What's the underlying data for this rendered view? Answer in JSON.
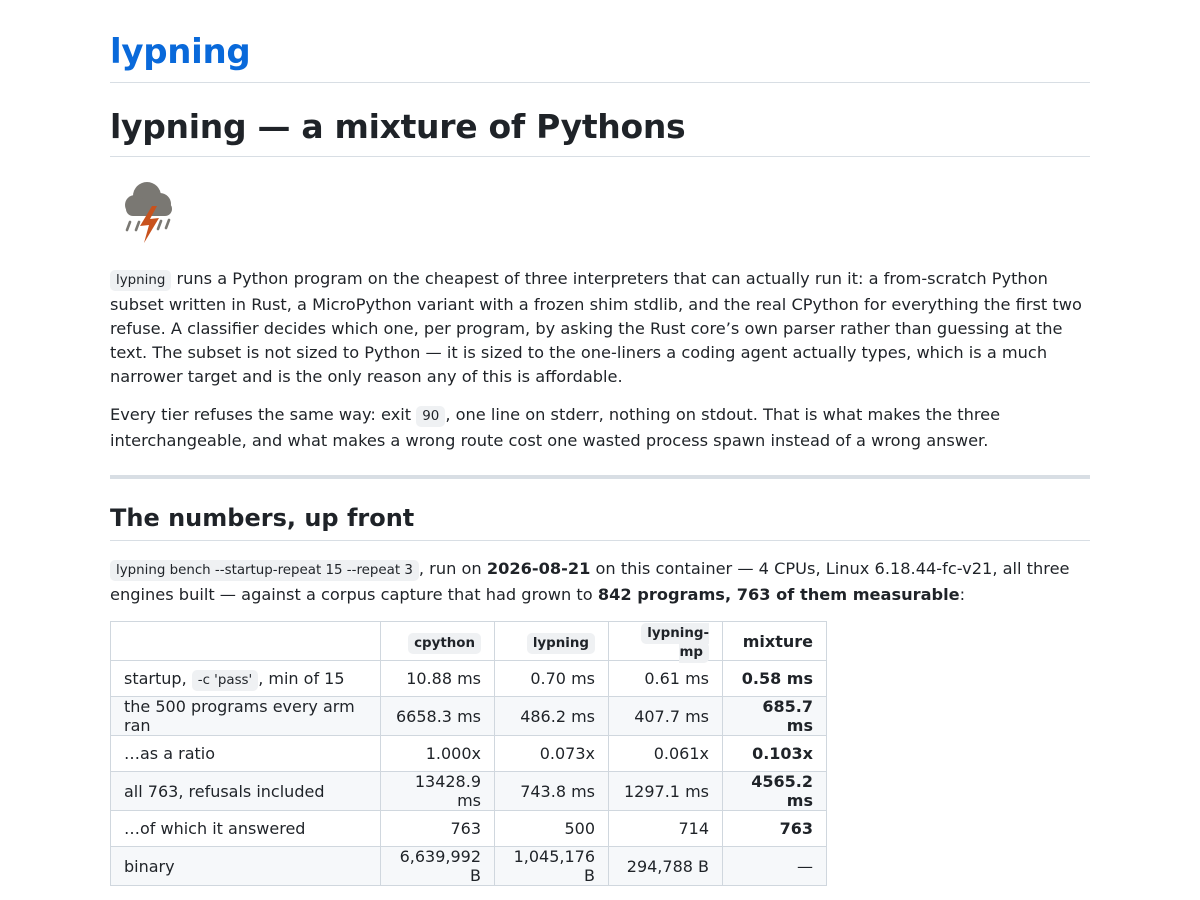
{
  "site": {
    "title": "lypning"
  },
  "article": {
    "heading": "lypning — a mixture of Pythons",
    "logo_icon": "thunderstorm-cloud-icon",
    "intro": {
      "code": "lypning",
      "text": " runs a Python program on the cheapest of three interpreters that can actually run it: a from-scratch Python subset written in Rust, a MicroPython variant with a frozen shim stdlib, and the real CPython for everything the first two refuse. A classifier decides which one, per program, by asking the Rust core’s own parser rather than guessing at the text. The subset is not sized to Python — it is sized to the one-liners a coding agent actually types, which is a much narrower target and is the only reason any of this is affordable."
    },
    "refusal": {
      "before": "Every tier refuses the same way: exit ",
      "code": "90",
      "after": ", one line on stderr, nothing on stdout. That is what makes the three interchangeable, and what makes a wrong route cost one wasted process spawn instead of a wrong answer."
    },
    "numbers_section": {
      "heading": "The numbers, up front",
      "command": "lypning bench --startup-repeat 15 --repeat 3",
      "text_1": ", run on ",
      "date": "2026-08-21",
      "text_2": " on this container — 4 CPUs, Linux 6.18.44-fc-v21, all three engines built — against a corpus capture that had grown to ",
      "corpus": "842 programs, 763 of them measurable",
      "text_3": ":"
    }
  },
  "table": {
    "headers": [
      "",
      "cpython",
      "lypning",
      "lypning-mp",
      "mixture"
    ],
    "startup_row": {
      "label_before": "startup, ",
      "label_code": "-c 'pass'",
      "label_after": ", min of 15",
      "cells": [
        "10.88 ms",
        "0.70 ms",
        "0.61 ms",
        "0.58 ms"
      ]
    },
    "rows": [
      {
        "label": "the 500 programs every arm ran",
        "cells": [
          "6658.3 ms",
          "486.2 ms",
          "407.7 ms",
          "685.7 ms"
        ]
      },
      {
        "label": "…as a ratio",
        "cells": [
          "1.000x",
          "0.073x",
          "0.061x",
          "0.103x"
        ]
      },
      {
        "label": "all 763, refusals included",
        "cells": [
          "13428.9 ms",
          "743.8 ms",
          "1297.1 ms",
          "4565.2 ms"
        ]
      },
      {
        "label": "…of which it answered",
        "cells": [
          "763",
          "500",
          "714",
          "763"
        ]
      },
      {
        "label": "binary",
        "cells": [
          "6,639,992 B",
          "1,045,176 B",
          "294,788 B",
          "—"
        ]
      }
    ]
  }
}
